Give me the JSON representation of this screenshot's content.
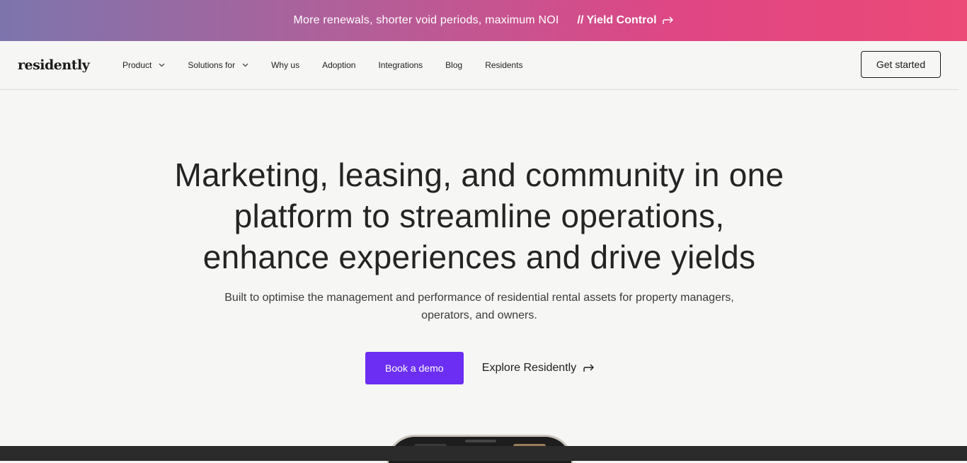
{
  "announcement": {
    "message": "More renewals, shorter void periods, maximum NOI",
    "cta_label": "// Yield Control"
  },
  "header": {
    "logo": "residently",
    "nav": [
      {
        "label": "Product",
        "has_dropdown": true
      },
      {
        "label": "Solutions for",
        "has_dropdown": true
      },
      {
        "label": "Why us",
        "has_dropdown": false
      },
      {
        "label": "Adoption",
        "has_dropdown": false
      },
      {
        "label": "Integrations",
        "has_dropdown": false
      },
      {
        "label": "Blog",
        "has_dropdown": false
      },
      {
        "label": "Residents",
        "has_dropdown": false
      }
    ],
    "get_started_label": "Get started"
  },
  "hero": {
    "title_lines": [
      "Marketing, leasing, and community in one",
      "platform to streamline operations,",
      "enhance experiences and drive yields"
    ],
    "subtitle_lines": [
      "Built to optimise the management and performance of residential rental assets for property managers,",
      "operators, and owners."
    ],
    "book_demo_label": "Book a demo",
    "explore_label": "Explore Residently"
  },
  "colors": {
    "primary_button": "#6c2ef2",
    "banner_gradient_start": "#7d75ad",
    "banner_gradient_end": "#ec4a77",
    "background": "#f6f6f4"
  }
}
